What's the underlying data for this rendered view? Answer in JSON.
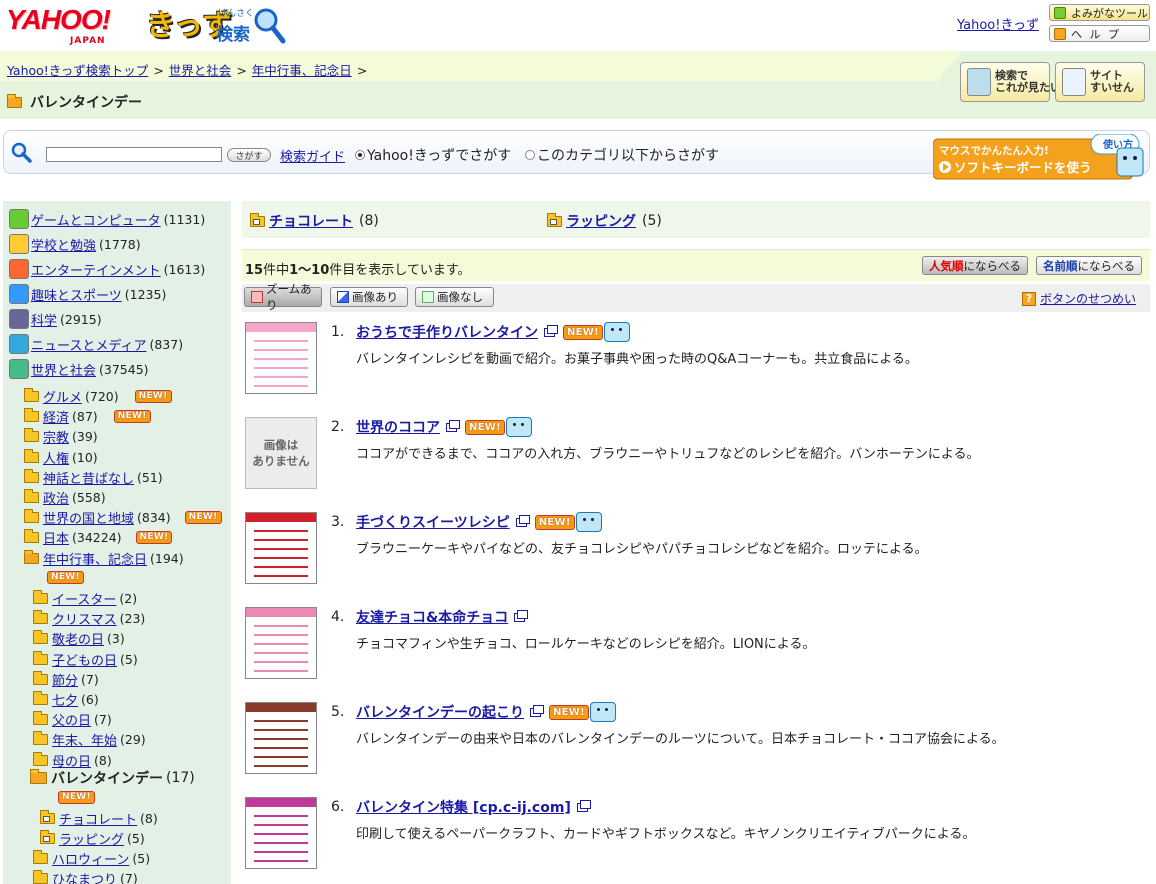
{
  "header": {
    "logo_text": "YAHOO!",
    "logo_japan": "JAPAN",
    "logo_kids": "きっず",
    "logo_kana": "けんさく",
    "logo_kensaku": "検索",
    "top_link": "Yahoo!きっず",
    "yomigana_btn": "よみがなツール",
    "help_btn": "ヘ ル プ"
  },
  "breadcrumb": {
    "items": [
      "Yahoo!きっず検索トップ",
      "世界と社会",
      "年中行事、記念日"
    ],
    "sep": ">"
  },
  "category_title": "バレンタインデー",
  "big_buttons": [
    {
      "label": "検索で\nこれが見たい"
    },
    {
      "label": "サイト\nすいせん"
    }
  ],
  "search": {
    "button": "さがす",
    "guide": "検索ガイド",
    "radio1": "Yahoo!きっずでさがす",
    "radio2": "このカテゴリ以下からさがす",
    "kb_line1": "マウスでかんたん入力!",
    "kb_howto": "使い方",
    "kb_line2": "ソフトキーボードを使う"
  },
  "sidebar": {
    "top": [
      {
        "label": "ゲームとコンピュータ",
        "count": "(1131)",
        "color": "#6c3"
      },
      {
        "label": "学校と勉強",
        "count": "(1778)",
        "color": "#fc3"
      },
      {
        "label": "エンターテインメント",
        "count": "(1613)",
        "color": "#f63"
      },
      {
        "label": "趣味とスポーツ",
        "count": "(1235)",
        "color": "#39f"
      },
      {
        "label": "科学",
        "count": "(2915)",
        "color": "#669"
      },
      {
        "label": "ニュースとメディア",
        "count": "(837)",
        "color": "#3ad"
      },
      {
        "label": "世界と社会",
        "count": "(37545)",
        "color": "#4b8"
      }
    ],
    "sub": [
      {
        "label": "グルメ",
        "count": "(720)",
        "new": true
      },
      {
        "label": "経済",
        "count": "(87)",
        "new": true
      },
      {
        "label": "宗教",
        "count": "(39)",
        "new": false
      },
      {
        "label": "人権",
        "count": "(10)",
        "new": false
      },
      {
        "label": "神話と昔ばなし",
        "count": "(51)",
        "new": false
      },
      {
        "label": "政治",
        "count": "(558)",
        "new": false
      },
      {
        "label": "世界の国と地域",
        "count": "(834)",
        "new": true
      },
      {
        "label": "日本",
        "count": "(34224)",
        "new": true
      },
      {
        "label": "年中行事、記念日",
        "count": "(194)",
        "new": false
      }
    ],
    "events": [
      {
        "label": "イースター",
        "count": "(2)"
      },
      {
        "label": "クリスマス",
        "count": "(23)"
      },
      {
        "label": "敬老の日",
        "count": "(3)"
      },
      {
        "label": "子どもの日",
        "count": "(5)"
      },
      {
        "label": "節分",
        "count": "(7)"
      },
      {
        "label": "七夕",
        "count": "(6)"
      },
      {
        "label": "父の日",
        "count": "(7)"
      },
      {
        "label": "年末、年始",
        "count": "(29)"
      },
      {
        "label": "母の日",
        "count": "(8)"
      }
    ],
    "current": {
      "label": "バレンタインデー",
      "count": "(17)"
    },
    "current_sub": [
      {
        "label": "チョコレート",
        "count": "(8)"
      },
      {
        "label": "ラッピング",
        "count": "(5)"
      }
    ],
    "after": [
      {
        "label": "ハロウィーン",
        "count": "(5)"
      },
      {
        "label": "ひなまつり",
        "count": "(7)"
      }
    ],
    "new_label": "NEW!"
  },
  "subcats": [
    {
      "label": "チョコレート",
      "count": "(8)"
    },
    {
      "label": "ラッピング",
      "count": "(5)"
    }
  ],
  "results_bar": {
    "total": "15",
    "t1": "件中",
    "range": "1〜10",
    "t2": "件目を表示しています。",
    "sort1_hl": "人気順",
    "sort1_rest": "にならべる",
    "sort2_hl": "名前順",
    "sort2_rest": "にならべる"
  },
  "view_bar": {
    "zoom": "ズームあり",
    "img": "画像あり",
    "noimg": "画像なし",
    "explain": "ボタンのせつめい"
  },
  "no_image_text": "画像は\nありません",
  "results": [
    {
      "num": "1.",
      "title": "おうちで手作りバレンタイン",
      "new": true,
      "desc": "バレンタインレシピを動画で紹介。お菓子事典や困った時のQ&Aコーナーも。共立食品による。",
      "thumb": "#f4a6c8",
      "has_img": true
    },
    {
      "num": "2.",
      "title": "世界のココア",
      "new": true,
      "desc": "ココアができるまで、ココアの入れ方、ブラウニーやトリュフなどのレシピを紹介。バンホーテンによる。",
      "thumb": "",
      "has_img": false
    },
    {
      "num": "3.",
      "title": "手づくりスイーツレシピ",
      "new": true,
      "desc": "ブラウニーケーキやパイなどの、友チョコレシピやパパチョコレシピなどを紹介。ロッテによる。",
      "thumb": "#d21f2b",
      "has_img": true
    },
    {
      "num": "4.",
      "title": "友達チョコ&本命チョコ",
      "new": false,
      "desc": "チョコマフィンや生チョコ、ロールケーキなどのレシピを紹介。LIONによる。",
      "thumb": "#e88ab4",
      "has_img": true
    },
    {
      "num": "5.",
      "title": "バレンタインデーの起こり",
      "new": true,
      "desc": "バレンタインデーの由来や日本のバレンタインデーのルーツについて。日本チョコレート・ココア協会による。",
      "thumb": "#8a3b2a",
      "has_img": true
    },
    {
      "num": "6.",
      "title": "バレンタイン特集 [cp.c-ij.com]",
      "new": false,
      "desc": "印刷して使えるペーパークラフト、カードやギフトボックスなど。キヤノンクリエイティブパークによる。",
      "thumb": "#c0399b",
      "has_img": true
    }
  ]
}
